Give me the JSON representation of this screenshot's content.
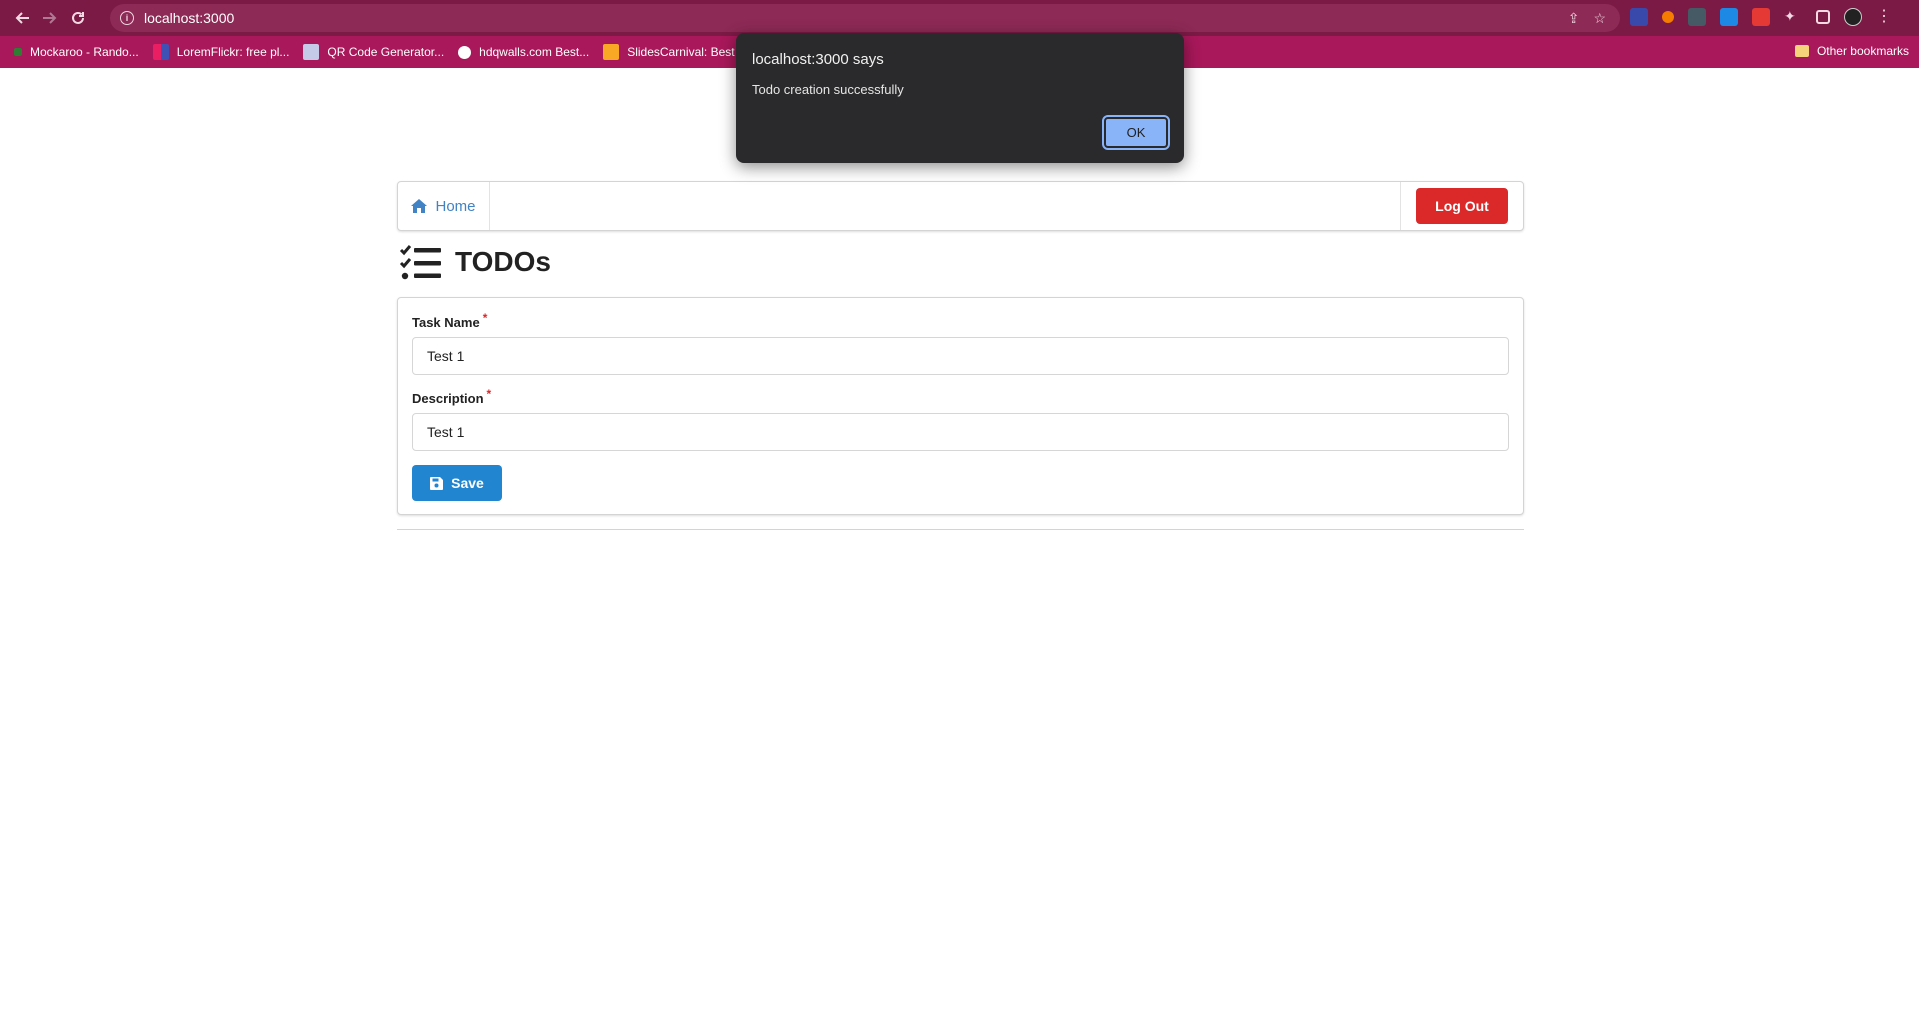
{
  "browser": {
    "url": "localhost:3000",
    "bookmarks": [
      {
        "label": "Mockaroo - Rando...",
        "color": "#2e7d32"
      },
      {
        "label": "LoremFlickr: free pl...",
        "color": "#e91e63"
      },
      {
        "label": "QR Code Generator...",
        "color": "#5c6bc0"
      },
      {
        "label": "hdqwalls.com Best...",
        "color": "#ffffff"
      },
      {
        "label": "SlidesCarnival: Best",
        "color": "#f9a825"
      }
    ],
    "other_bookmarks": "Other bookmarks"
  },
  "nav": {
    "home_label": "Home",
    "logout_label": "Log Out"
  },
  "page": {
    "title": "TODOs"
  },
  "form": {
    "task_name_label": "Task Name",
    "task_name_value": "Test 1",
    "description_label": "Description",
    "description_value": "Test 1",
    "required_mark": "*",
    "save_label": "Save"
  },
  "dialog": {
    "title": "localhost:3000 says",
    "message": "Todo creation successfully",
    "ok_label": "OK"
  },
  "colors": {
    "toolbar": "#7a1a45",
    "bookmarks_bar": "#a8185a",
    "logout": "#db2828",
    "save": "#2185d0",
    "link": "#4183c4",
    "dialog_bg": "#2a2a2c",
    "dialog_button": "#8ab4f8"
  }
}
